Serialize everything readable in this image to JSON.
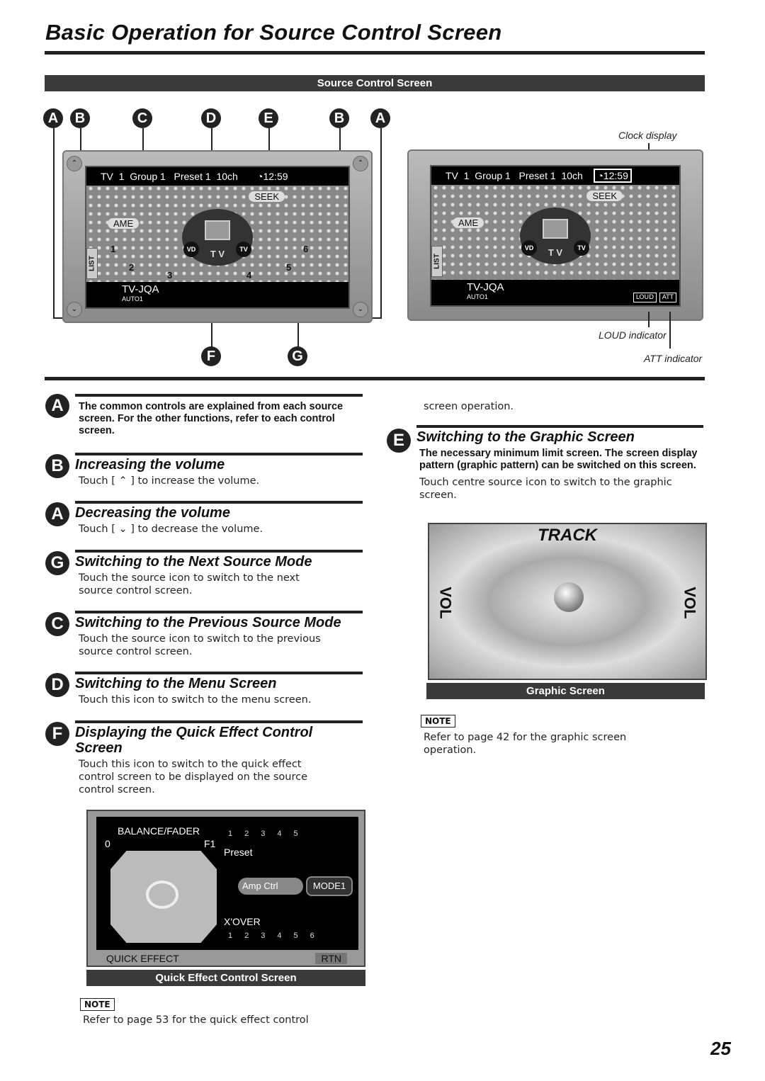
{
  "title": "Basic Operation for Source Control Screen",
  "banner": "Source Control Screen",
  "top_letters": [
    "A",
    "B",
    "C",
    "D",
    "E",
    "B",
    "A"
  ],
  "bottom_letters": [
    "F",
    "G"
  ],
  "screen": {
    "source": "TV",
    "band": "1",
    "group": "Group 1",
    "preset": "Preset 1",
    "ch": "10ch",
    "clock": "12:59",
    "seek": "SEEK",
    "ame": "AME",
    "presets": [
      "1",
      "2",
      "3",
      "4",
      "5",
      "6"
    ],
    "vd": "VD",
    "tv": "TV",
    "tv_label": "T V",
    "list": "LIST",
    "station": "TV-JQA",
    "sub": "AUTO1",
    "loud": "LOUD",
    "att": "ATT"
  },
  "callouts": {
    "clock": "Clock display",
    "loud": "LOUD indicator",
    "att": "ATT indicator"
  },
  "sections_left": [
    {
      "letter": "A",
      "heading": "",
      "bold": "The common controls are explained from each source screen. For the other functions, refer to each control screen.",
      "text": ""
    },
    {
      "letter": "B",
      "heading": "Increasing the volume",
      "bold": "",
      "text": "Touch [ ⌃ ] to increase the volume."
    },
    {
      "letter": "A",
      "heading": "Decreasing the volume",
      "bold": "",
      "text": "Touch [ ⌄ ] to decrease the volume."
    },
    {
      "letter": "G",
      "heading": "Switching to the Next Source Mode",
      "bold": "",
      "text": "Touch the source icon to switch to the next source control screen."
    },
    {
      "letter": "C",
      "heading": "Switching to the Previous Source Mode",
      "bold": "",
      "text": "Touch the source icon to switch to the previous source control screen."
    },
    {
      "letter": "D",
      "heading": "Switching to the Menu Screen",
      "bold": "",
      "text": "Touch this icon to switch to the menu screen."
    },
    {
      "letter": "F",
      "heading": "Displaying the Quick Effect Control Screen",
      "bold": "",
      "text": "Touch this icon to switch to the quick effect control screen to be displayed on the source control screen."
    }
  ],
  "quick_effect": {
    "title": "BALANCE/FADER",
    "left": "0",
    "right": "F1",
    "preset": "Preset",
    "preset_nums": [
      "1",
      "2",
      "3",
      "4",
      "5"
    ],
    "amp": "Amp Ctrl",
    "mode": "MODE1",
    "xover": "X'OVER",
    "xover_nums": [
      "1",
      "2",
      "3",
      "4",
      "5",
      "6"
    ],
    "footer": "QUICK EFFECT",
    "rtn": "RTN",
    "caption": "Quick Effect Control Screen"
  },
  "note_label": "NOTE",
  "note_left": "Refer to page 53 for the quick effect control",
  "right_cont": "screen operation.",
  "section_e": {
    "letter": "E",
    "heading": "Switching to the Graphic Screen",
    "bold": "The necessary minimum limit screen. The screen display pattern (graphic pattern) can be switched on this screen.",
    "text": "Touch centre source icon to switch to the graphic screen."
  },
  "graphic": {
    "track": "TRACK",
    "vol": "VOL",
    "caption": "Graphic Screen"
  },
  "note_right": "Refer to page 42 for the graphic screen operation.",
  "page_number": "25"
}
